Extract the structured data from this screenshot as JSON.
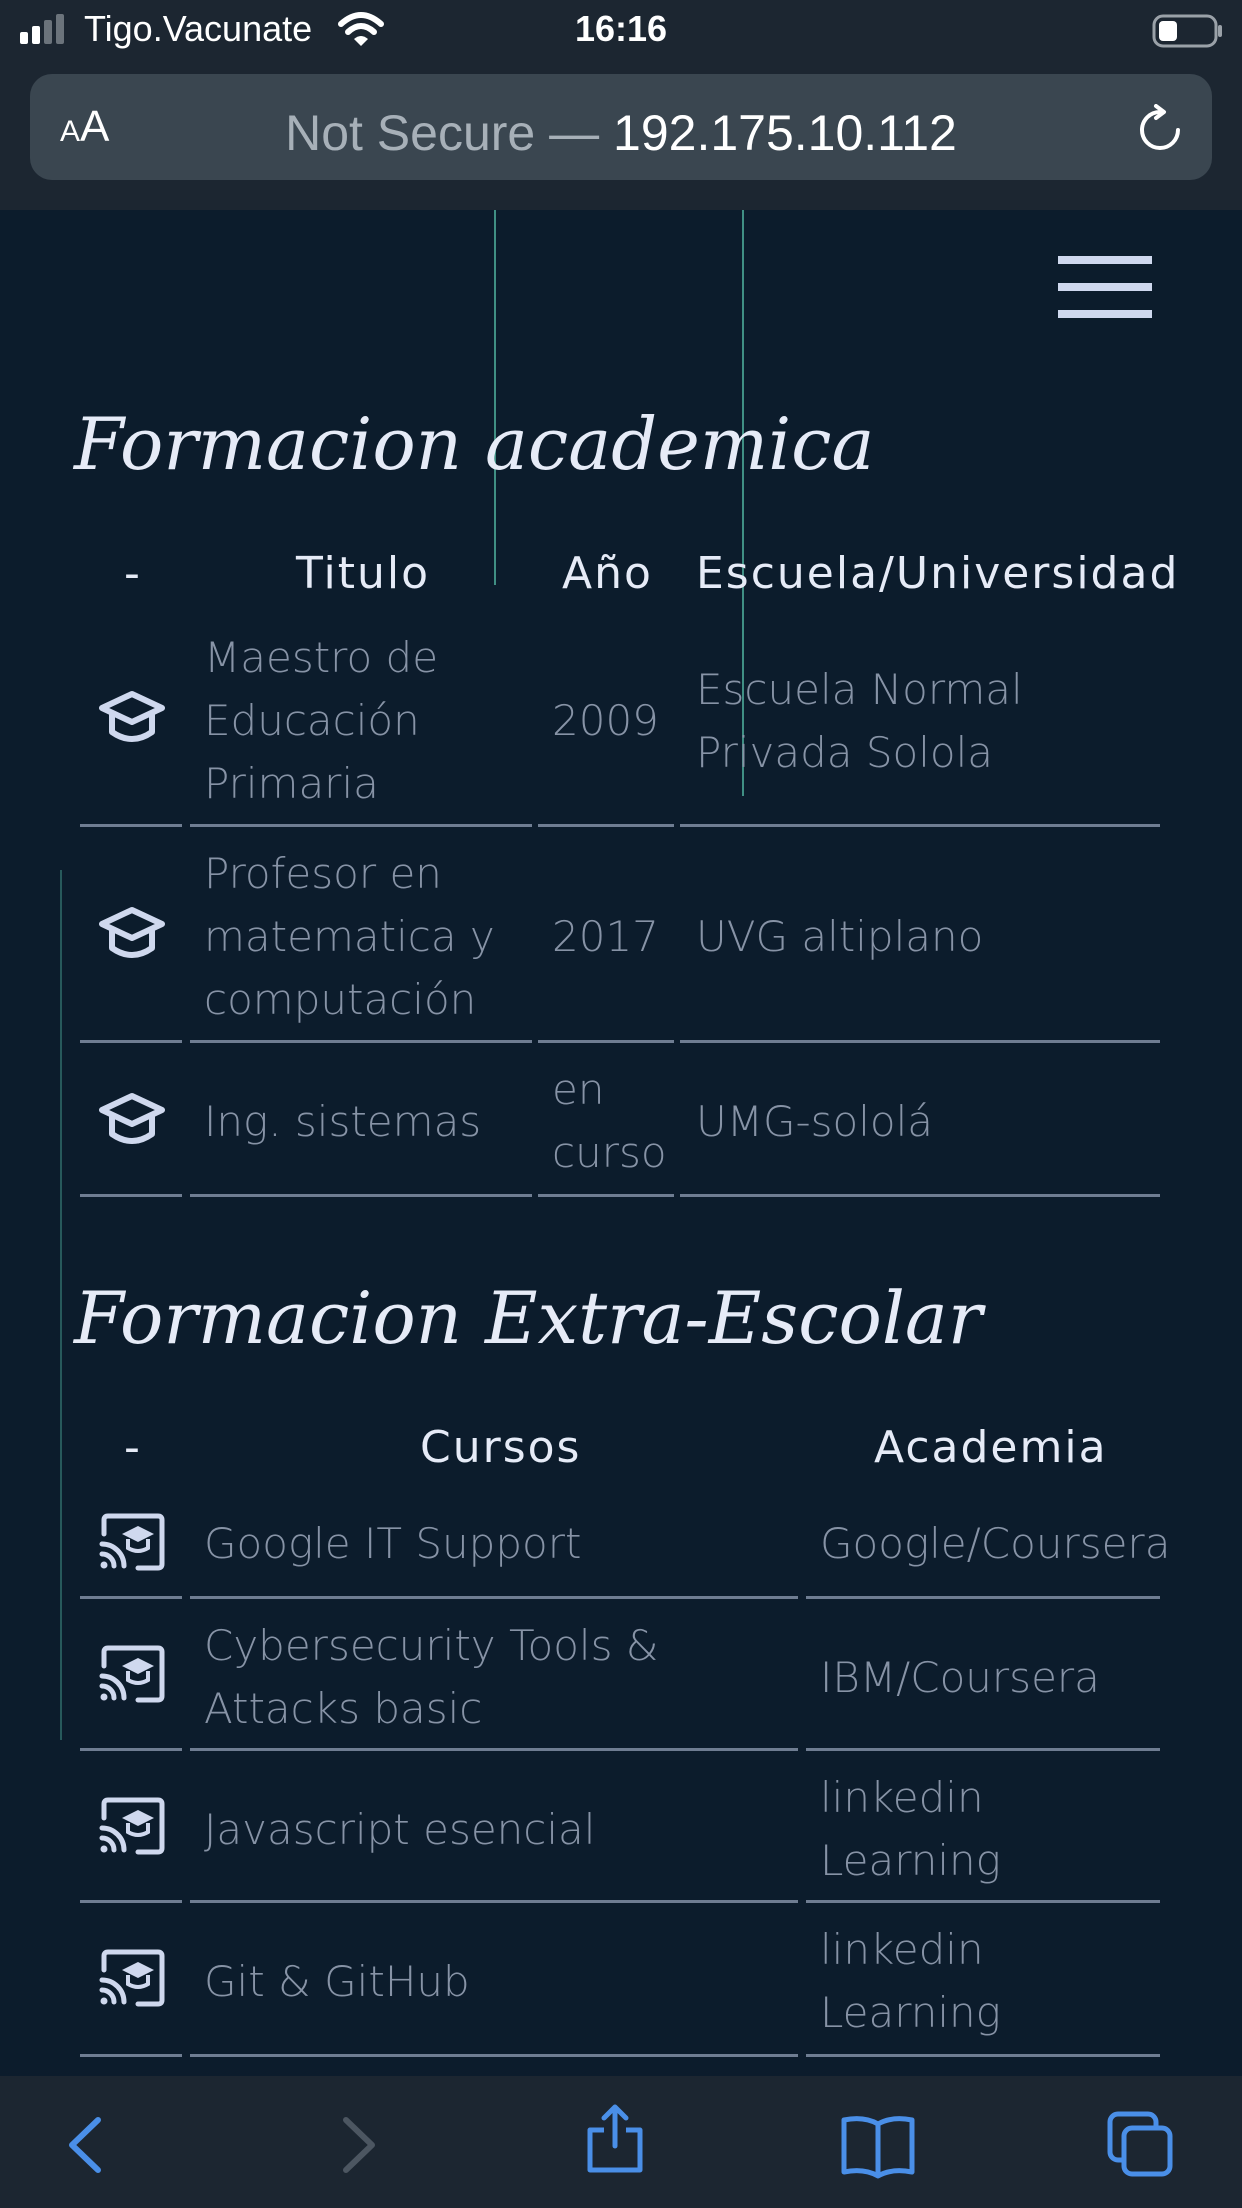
{
  "status_bar": {
    "carrier": "Tigo.Vacunate",
    "time": "16:16"
  },
  "browser": {
    "text_size_label": "AA",
    "url_prefix": "Not Secure — ",
    "url_host": "192.175.10.112"
  },
  "academic": {
    "title": "Formacion academica",
    "headers": {
      "icon": "-",
      "title": "Titulo",
      "year": "Año",
      "school": "Escuela/Universidad"
    },
    "rows": [
      {
        "icon": "graduation-cap-icon",
        "title": "Maestro de Educación Primaria",
        "year": "2009",
        "school": "Escuela Normal Privada Solola"
      },
      {
        "icon": "graduation-cap-icon",
        "title": "Profesor en matematica y computación",
        "year": "2017",
        "school": "UVG altiplano"
      },
      {
        "icon": "graduation-cap-icon",
        "title": "Ing. sistemas",
        "year": "en curso",
        "school": "UMG-sololá"
      }
    ]
  },
  "extra": {
    "title": "Formacion Extra-Escolar",
    "headers": {
      "icon": "-",
      "course": "Cursos",
      "academy": "Academia"
    },
    "rows": [
      {
        "icon": "online-education-icon",
        "course": "Google IT Support",
        "academy": "Google/Coursera"
      },
      {
        "icon": "online-education-icon",
        "course": "Cybersecurity Tools & Attacks basic",
        "academy": "IBM/Coursera"
      },
      {
        "icon": "online-education-icon",
        "course": "Javascript esencial",
        "academy": "linkedin Learning"
      },
      {
        "icon": "online-education-icon",
        "course": "Git & GitHub",
        "academy": "linkedin Learning"
      }
    ]
  },
  "colors": {
    "page_bg": "#0c1c2c",
    "chrome_bg": "#1c2631",
    "accent_blue": "#4a8fe8",
    "decor_line": "#4aa394"
  }
}
